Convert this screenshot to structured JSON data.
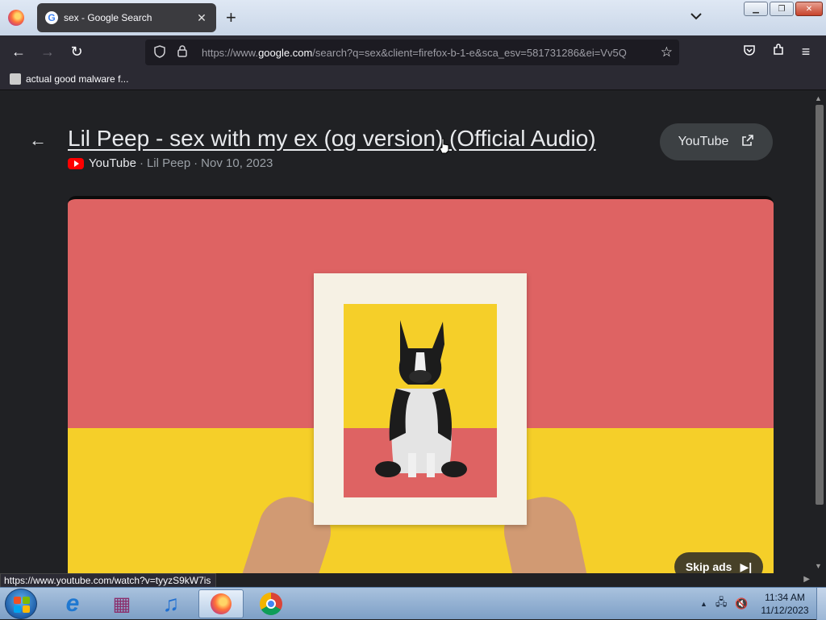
{
  "browser": {
    "tab": {
      "title": "sex - Google Search",
      "favicon_letter": "G",
      "close_glyph": "✕"
    },
    "new_tab_glyph": "+",
    "tab_list_glyph": "⌄",
    "window_controls": {
      "minimize": "▁",
      "restore": "❐",
      "close": "✕"
    },
    "nav": {
      "back": "←",
      "forward": "→",
      "reload": "↻",
      "star": "☆",
      "pocket": "◡",
      "extensions": "⧉",
      "menu": "≡"
    },
    "url": {
      "prefix": "https://www.",
      "domain": "google.com",
      "suffix": "/search?q=sex&client=firefox-b-1-e&sca_esv=581731286&ei=Vv5Q"
    },
    "bookmark": {
      "label": "actual good malware f..."
    },
    "status_url": "https://www.youtube.com/watch?v=tyyzS9kW7is"
  },
  "content": {
    "back_glyph": "←",
    "video_title": "Lil Peep - sex with my ex (og version) (Official Audio)",
    "meta": {
      "source": "YouTube",
      "separator1": "·",
      "channel": "Lil Peep",
      "separator2": "·",
      "date": "Nov 10, 2023"
    },
    "youtube_button": {
      "label": "YouTube",
      "icon_glyph": "⧉"
    },
    "player": {
      "skip_label": "Skip ads",
      "skip_glyph": "▶|"
    }
  },
  "taskbar": {
    "apps": [
      {
        "name": "internet-explorer-icon",
        "glyph": "e"
      },
      {
        "name": "winrar-icon",
        "glyph": "▦"
      },
      {
        "name": "itunes-icon",
        "glyph": "♫"
      },
      {
        "name": "firefox-icon",
        "glyph": ""
      },
      {
        "name": "chrome-icon",
        "glyph": ""
      }
    ],
    "clock": {
      "time": "11:34 AM",
      "date": "11/12/2023"
    },
    "tray_glyphs": {
      "show_hidden": "▲",
      "network": "🖧",
      "volume": "🔇"
    }
  },
  "colors": {
    "page_bg": "#202124",
    "toolbar_bg": "#2b2a33",
    "youtube_red": "#ff0000",
    "video_pink": "#de6363",
    "video_yellow": "#f5cf29"
  }
}
